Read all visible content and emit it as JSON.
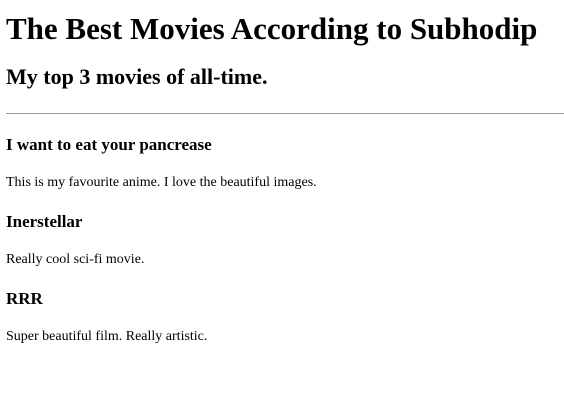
{
  "page": {
    "title": "The Best Movies According to Subhodip",
    "subtitle": "My top 3 movies of all-time."
  },
  "movies": [
    {
      "title": "I want to eat your pancrease",
      "description": "This is my favourite anime. I love the beautiful images."
    },
    {
      "title": "Inerstellar",
      "description": "Really cool sci-fi movie."
    },
    {
      "title": "RRR",
      "description": "Super beautiful film. Really artistic."
    }
  ]
}
